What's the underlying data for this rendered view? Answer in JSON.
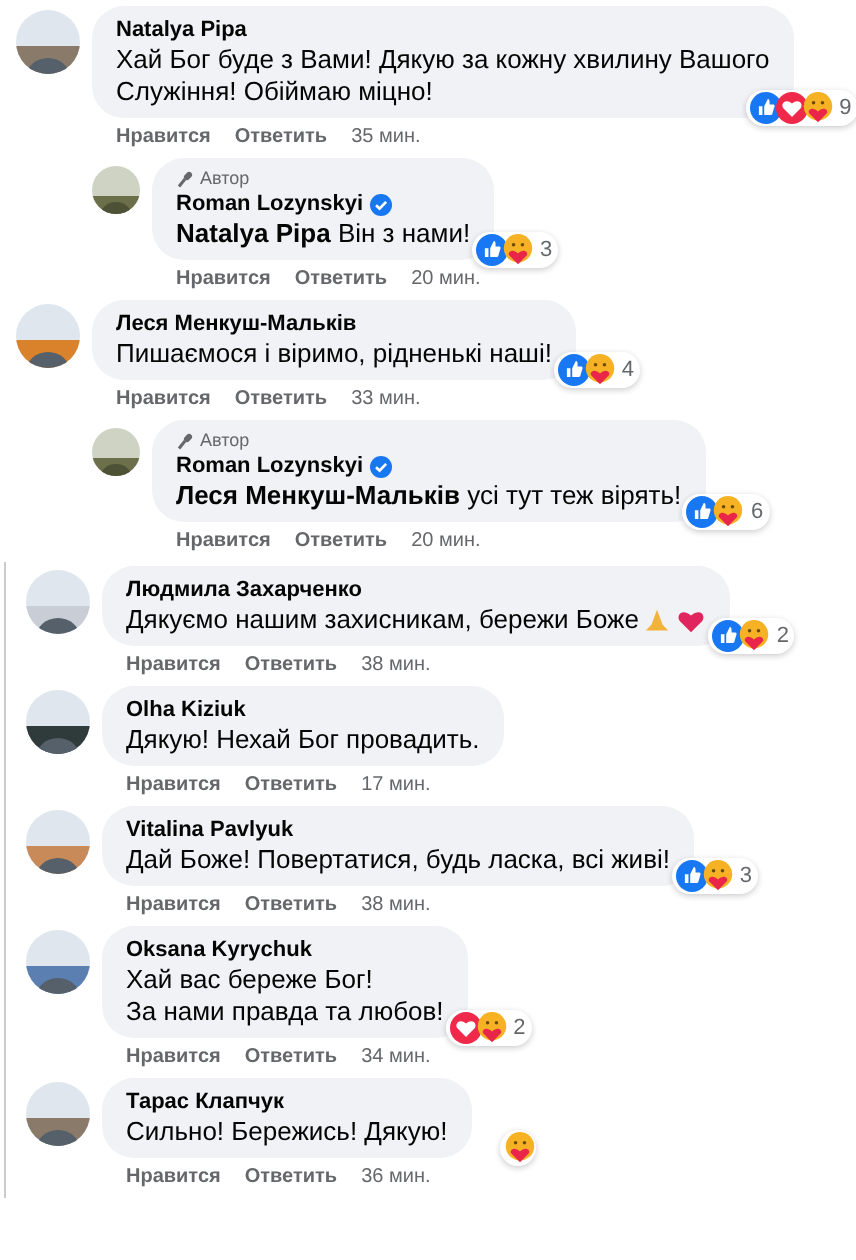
{
  "sections": [
    {
      "comments": [
        {
          "author": "Natalya Pipa",
          "text": "Хай Бог буде з Вами! Дякую за кожну хвилину Вашого\nСлужіння! Обіймаю міцно!",
          "reactions": {
            "kinds": [
              {
                "kind": "like"
              },
              {
                "kind": "love"
              },
              {
                "kind": "care"
              }
            ],
            "count": "9"
          },
          "actions": [
            "Нравится",
            "Ответить"
          ],
          "time": "35 мин.",
          "replies": [
            {
              "badge": "Автор",
              "author": "Roman Lozynskyi",
              "verified": true,
              "text": "**Natalya Pipa** Він з нами!",
              "reactions": {
                "kinds": [
                  {
                    "kind": "like"
                  },
                  {
                    "kind": "care"
                  }
                ],
                "count": "3"
              },
              "actions": [
                "Нравится",
                "Ответить"
              ],
              "time": "20 мин."
            }
          ]
        },
        {
          "author": "Леся Менкуш-Мальків",
          "text": "Пишаємося і віримо, рідненькі наші!",
          "reactions": {
            "kinds": [
              {
                "kind": "like"
              },
              {
                "kind": "care"
              }
            ],
            "count": "4"
          },
          "actions": [
            "Нравится",
            "Ответить"
          ],
          "time": "33 мин.",
          "replies": [
            {
              "badge": "Автор",
              "author": "Roman Lozynskyi",
              "verified": true,
              "text": "**Леся Менкуш-Мальків** усі тут теж вірять!",
              "reactions": {
                "kinds": [
                  {
                    "kind": "like"
                  },
                  {
                    "kind": "care"
                  }
                ],
                "count": "6"
              },
              "actions": [
                "Нравится",
                "Ответить"
              ],
              "time": "20 мин."
            }
          ]
        }
      ]
    },
    {
      "comments": [
        {
          "author": "Людмила Захарченко",
          "text": "Дякуємо нашим захисникам, бережи Боже",
          "text_emoji": [
            {
              "kind": "pray"
            },
            {
              "kind": "heart"
            }
          ],
          "reactions": {
            "kinds": [
              {
                "kind": "like"
              },
              {
                "kind": "care"
              }
            ],
            "count": "2"
          },
          "actions": [
            "Нравится",
            "Ответить"
          ],
          "time": "38 мин."
        },
        {
          "author": "Olha Kiziuk",
          "text": "Дякую! Нехай Бог провадить.",
          "actions": [
            "Нравится",
            "Ответить"
          ],
          "time": "17 мин."
        },
        {
          "author": "Vitalina Pavlyuk",
          "text": "Дай Боже! Повертатися, будь ласка, всі живі!",
          "reactions": {
            "kinds": [
              {
                "kind": "like"
              },
              {
                "kind": "care"
              }
            ],
            "count": "3"
          },
          "actions": [
            "Нравится",
            "Ответить"
          ],
          "time": "38 мин."
        },
        {
          "author": "Oksana Kyrychuk",
          "text": "Хай вас береже Бог!\nЗа нами правда та любов!",
          "reactions": {
            "kinds": [
              {
                "kind": "love"
              },
              {
                "kind": "care"
              }
            ],
            "count": "2"
          },
          "actions": [
            "Нравится",
            "Ответить"
          ],
          "time": "34 мин."
        },
        {
          "author": "Тарас Клапчук",
          "text": "Сильно! Бережись! Дякую!",
          "reactions": {
            "kinds": [
              {
                "kind": "care"
              }
            ]
          },
          "actions": [
            "Нравится",
            "Ответить"
          ],
          "time": "36 мин."
        }
      ]
    }
  ]
}
